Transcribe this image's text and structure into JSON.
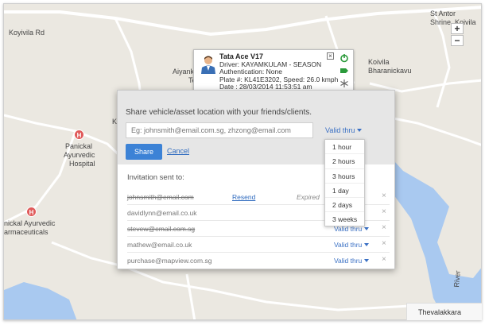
{
  "map": {
    "labels": {
      "koyivila_rd": "Koyivila Rd",
      "st_anton": "St Antor",
      "shrine_koivila": "Shrine, Koivila",
      "koivila_bharanickavu_1": "Koivila",
      "koivila_bharanickavu_2": "Bharanickavu",
      "aiyank": "Aiyank",
      "te": "Te",
      "ki": "Ki",
      "panickal_1": "Panickal",
      "panickal_2": "Ayurvedic",
      "panickal_3": "Hospital",
      "pharma_1": "nickal Ayurvedic",
      "pharma_2": "armaceuticals",
      "river": "River",
      "thevalakkara": "Thevalakkara"
    },
    "hospital_icon_text": "H",
    "zoom_in": "+",
    "zoom_out": "−",
    "colors": {
      "land": "#ebe8e1",
      "water": "#a9c9f0",
      "road": "#ffffff"
    }
  },
  "vehicle": {
    "title": "Tata Ace V17",
    "driver": "Driver: KAYAMKULAM - SEASON",
    "authentication": "Authentication: None",
    "plate_speed": "Plate #: KL41E3202, Speed: 26.0 kmph",
    "date": "Date : 28/03/2014 11:53:51 am",
    "close_label": "×"
  },
  "share": {
    "heading": "Share vehicle/asset location with your friends/clients.",
    "email_placeholder": "Eg: johnsmith@email.com.sg, zhzong@email.com",
    "valid_label": "Valid thru",
    "share_button": "Share",
    "cancel_link": "Cancel",
    "sent_label": "Invitation sent to:",
    "invitations": [
      {
        "email": "johnsmith@email.com",
        "resend": "Resend",
        "status": "Expired",
        "valid": "",
        "struck": true
      },
      {
        "email": "davidlynn@email.co.uk",
        "resend": "",
        "status": "",
        "valid": "",
        "struck": false
      },
      {
        "email": "stevew@email.com.sg",
        "resend": "",
        "status": "",
        "valid": "Valid thru",
        "struck": true
      },
      {
        "email": "mathew@email.co.uk",
        "resend": "",
        "status": "",
        "valid": "Valid thru",
        "struck": false
      },
      {
        "email": "purchase@mapview.com.sg",
        "resend": "",
        "status": "",
        "valid": "Valid thru",
        "struck": false
      }
    ],
    "remove_label": "×",
    "dropdown_options": [
      "1 hour",
      "2 hours",
      "3 hours",
      "1 day",
      "2 days",
      "3 weeks"
    ]
  }
}
